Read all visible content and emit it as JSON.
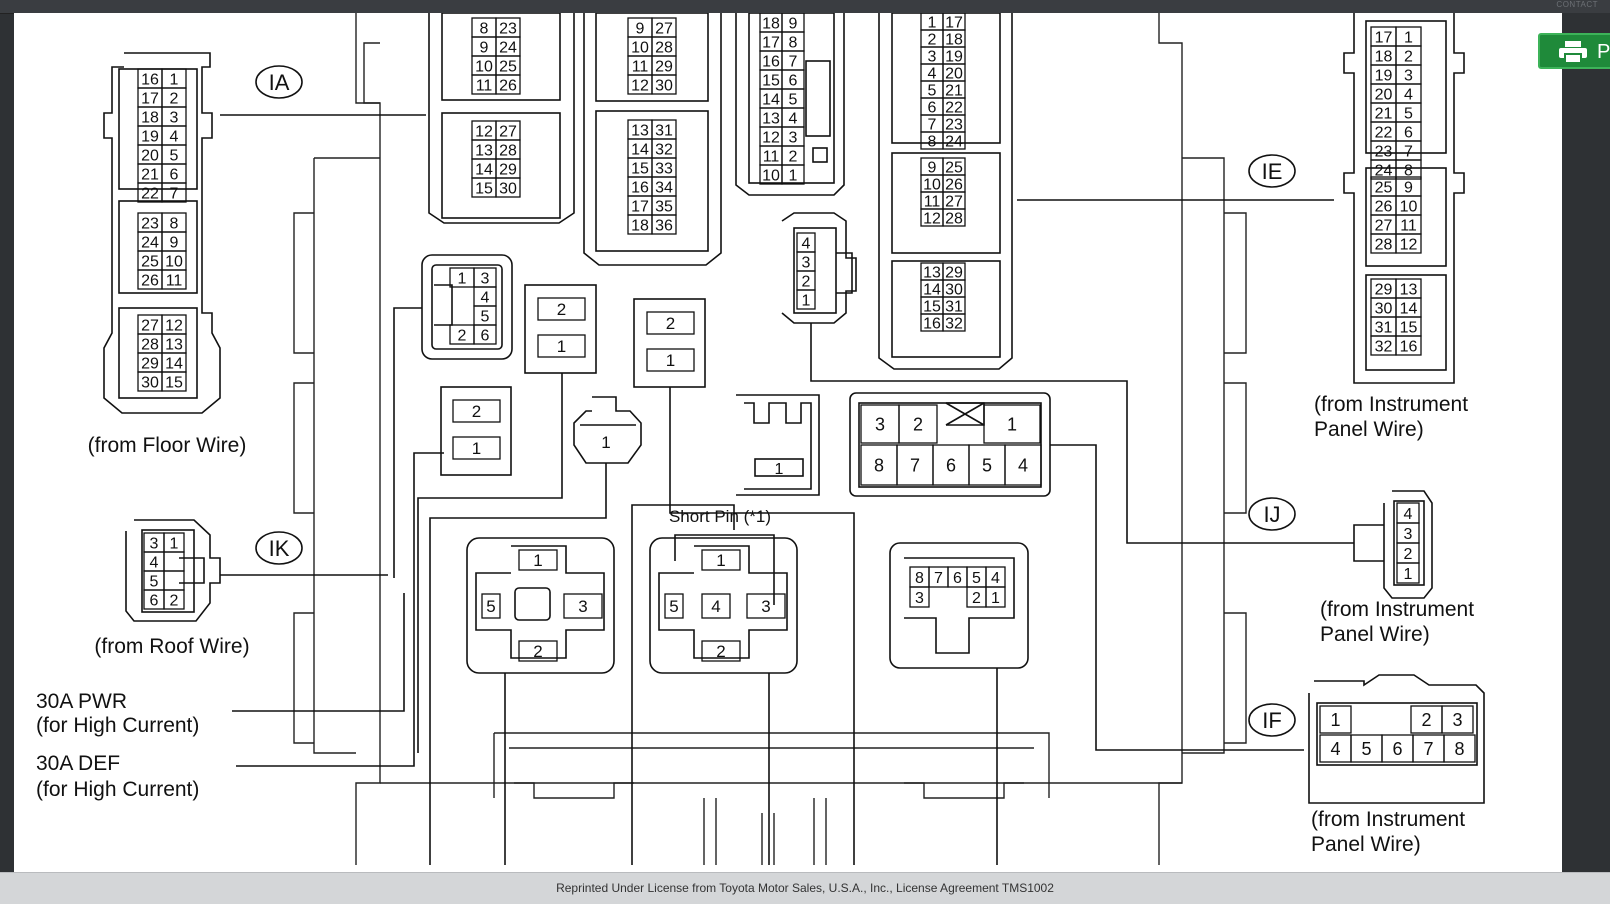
{
  "header": {
    "corner_text": "CONTACT"
  },
  "print_button": {
    "label": "P",
    "icon": "printer-icon",
    "color": "#1f8a3a"
  },
  "footer": {
    "license_text": "Reprinted Under License from Toyota Motor Sales, U.S.A., Inc., License Agreement TMS1002"
  },
  "connectors": {
    "IA": {
      "id": "IA",
      "from": "(from Floor Wire)",
      "pins": [
        [
          "16",
          "1"
        ],
        [
          "17",
          "2"
        ],
        [
          "18",
          "3"
        ],
        [
          "19",
          "4"
        ],
        [
          "20",
          "5"
        ],
        [
          "21",
          "6"
        ],
        [
          "22",
          "7"
        ],
        [
          "23",
          "8"
        ],
        [
          "24",
          "9"
        ],
        [
          "25",
          "10"
        ],
        [
          "26",
          "11"
        ],
        [
          "27",
          "12"
        ],
        [
          "28",
          "13"
        ],
        [
          "29",
          "14"
        ],
        [
          "30",
          "15"
        ]
      ]
    },
    "IK": {
      "id": "IK",
      "from": "(from Roof Wire)",
      "pins": [
        [
          "3",
          "1"
        ],
        [
          "4",
          ""
        ],
        [
          "5",
          ""
        ],
        [
          "6",
          "2"
        ]
      ]
    },
    "IE": {
      "id": "IE",
      "from_line1": "(from Instrument",
      "from_line2": "Panel Wire)",
      "pins": [
        [
          "17",
          "1"
        ],
        [
          "18",
          "2"
        ],
        [
          "19",
          "3"
        ],
        [
          "20",
          "4"
        ],
        [
          "21",
          "5"
        ],
        [
          "22",
          "6"
        ],
        [
          "23",
          "7"
        ],
        [
          "24",
          "8"
        ],
        [
          "25",
          "9"
        ],
        [
          "26",
          "10"
        ],
        [
          "27",
          "11"
        ],
        [
          "28",
          "12"
        ],
        [
          "29",
          "13"
        ],
        [
          "30",
          "14"
        ],
        [
          "31",
          "15"
        ],
        [
          "32",
          "16"
        ]
      ]
    },
    "IJ": {
      "id": "IJ",
      "from_line1": "(from Instrument",
      "from_line2": "Panel Wire)",
      "pins": [
        "4",
        "3",
        "2",
        "1"
      ]
    },
    "IF": {
      "id": "IF",
      "from_line1": "(from Instrument",
      "from_line2": "Panel Wire)",
      "pins_top": [
        "1",
        "2",
        "3"
      ],
      "pins_bottom": [
        "4",
        "5",
        "6",
        "7",
        "8"
      ]
    }
  },
  "block": {
    "a_pins": [
      [
        "8",
        "23"
      ],
      [
        "9",
        "24"
      ],
      [
        "10",
        "25"
      ],
      [
        "11",
        "26"
      ],
      [
        "12",
        "27"
      ],
      [
        "13",
        "28"
      ],
      [
        "14",
        "29"
      ],
      [
        "15",
        "30"
      ]
    ],
    "b_pins": [
      [
        "9",
        "27"
      ],
      [
        "10",
        "28"
      ],
      [
        "11",
        "29"
      ],
      [
        "12",
        "30"
      ],
      [
        "13",
        "31"
      ],
      [
        "14",
        "32"
      ],
      [
        "15",
        "33"
      ],
      [
        "16",
        "34"
      ],
      [
        "17",
        "35"
      ],
      [
        "18",
        "36"
      ]
    ],
    "c_pins": [
      [
        "18",
        "9"
      ],
      [
        "17",
        "8"
      ],
      [
        "16",
        "7"
      ],
      [
        "15",
        "6"
      ],
      [
        "14",
        "5"
      ],
      [
        "13",
        "4"
      ],
      [
        "12",
        "3"
      ],
      [
        "11",
        "2"
      ],
      [
        "10",
        "1"
      ]
    ],
    "d_pins": [
      [
        "1",
        "17"
      ],
      [
        "2",
        "18"
      ],
      [
        "3",
        "19"
      ],
      [
        "4",
        "20"
      ],
      [
        "5",
        "21"
      ],
      [
        "6",
        "22"
      ],
      [
        "7",
        "23"
      ],
      [
        "8",
        "24"
      ],
      [
        "9",
        "25"
      ],
      [
        "10",
        "26"
      ],
      [
        "11",
        "27"
      ],
      [
        "12",
        "28"
      ],
      [
        "13",
        "29"
      ],
      [
        "14",
        "30"
      ],
      [
        "15",
        "31"
      ],
      [
        "16",
        "32"
      ]
    ],
    "six_pin": [
      "1",
      "3",
      "4",
      "5",
      "2",
      "6"
    ],
    "four_pin_small": [
      "4",
      "3",
      "2",
      "1"
    ],
    "two_pin_a": [
      "2",
      "1"
    ],
    "two_pin_b": [
      "2",
      "1"
    ],
    "two_pin_c": [
      "2",
      "1"
    ],
    "single_pin_a": "1",
    "single_pin_b": "1",
    "eight_pin_top": [
      "3",
      "2",
      "1"
    ],
    "eight_pin_bottom": [
      "8",
      "7",
      "6",
      "5",
      "4"
    ],
    "relay_a": [
      "1",
      "5",
      "3",
      "2"
    ],
    "relay_b": [
      "1",
      "5",
      "4",
      "3",
      "2"
    ],
    "relay_c_top": [
      "8",
      "7",
      "6",
      "5",
      "4"
    ],
    "relay_c_bottom": [
      "3",
      "2",
      "1"
    ],
    "short_pin": "Short Pin (*1)",
    "pwr_label_1": "30A PWR",
    "pwr_label_2": "(for High Current)",
    "def_label_1": "30A DEF",
    "def_label_2": "(for High Current)"
  }
}
